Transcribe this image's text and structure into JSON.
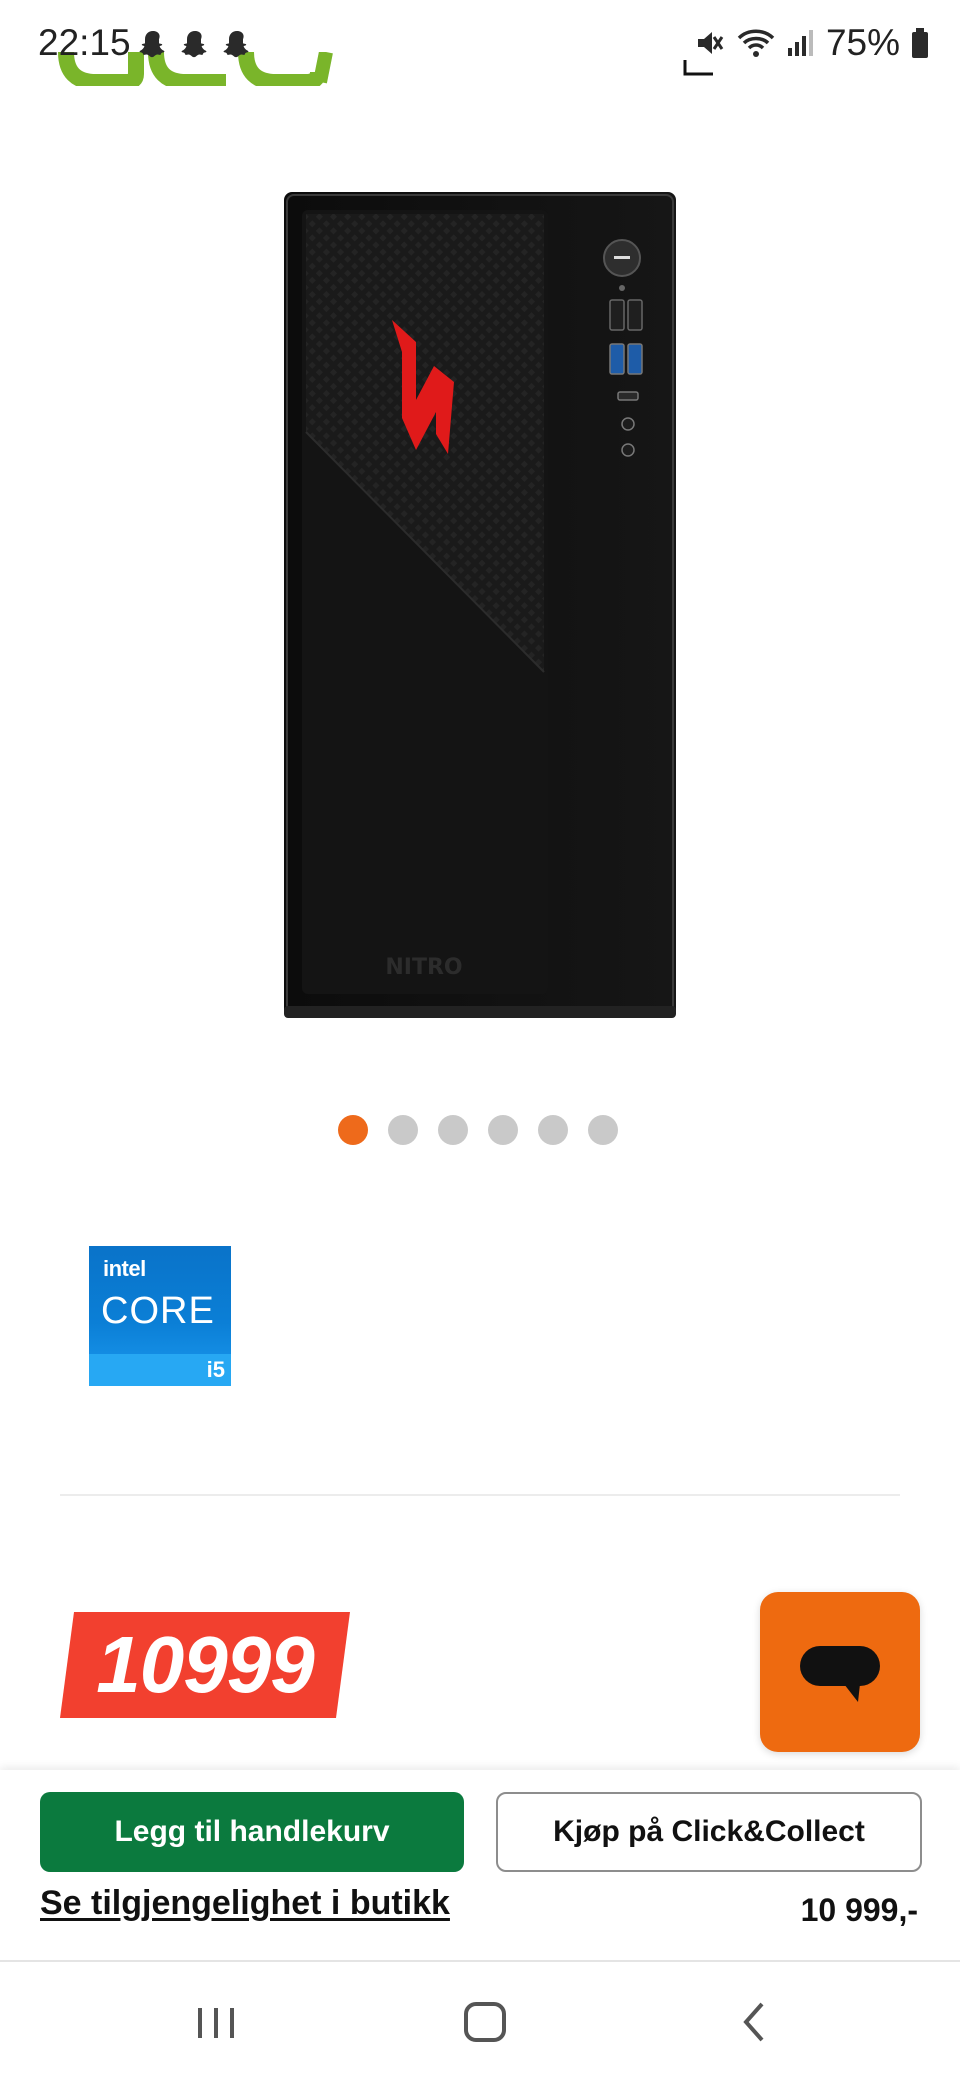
{
  "status_bar": {
    "time": "22:15",
    "battery": "75%",
    "icons": [
      "snapchat-icon",
      "snapchat-icon",
      "snapchat-icon",
      "mute-icon",
      "wifi-icon",
      "signal-icon",
      "battery-icon"
    ]
  },
  "header": {
    "logo": "acer",
    "cart_icon": "cart-icon"
  },
  "product": {
    "image": "acer-nitro-desktop-tower",
    "image_logo_text": "NITRO",
    "carousel": {
      "total": 6,
      "active_index": 0
    },
    "badge": {
      "brand": "intel",
      "line": "CORE",
      "tier": "i5"
    },
    "price_tag": "10999"
  },
  "chat": {
    "icon": "chat-bubble-icon",
    "color": "#ee6a10"
  },
  "actions": {
    "add_to_cart": "Legg til handlekurv",
    "click_collect": "Kjøp på Click&Collect",
    "store_availability": "Se tilgjengelighet i butikk",
    "price": "10 999,-"
  },
  "colors": {
    "accent_orange": "#ee6a1b",
    "cart_green": "#0b7a3e",
    "price_red": "#f2402f"
  },
  "nav_bar": {
    "buttons": [
      "recents-icon",
      "home-icon",
      "back-icon"
    ]
  }
}
